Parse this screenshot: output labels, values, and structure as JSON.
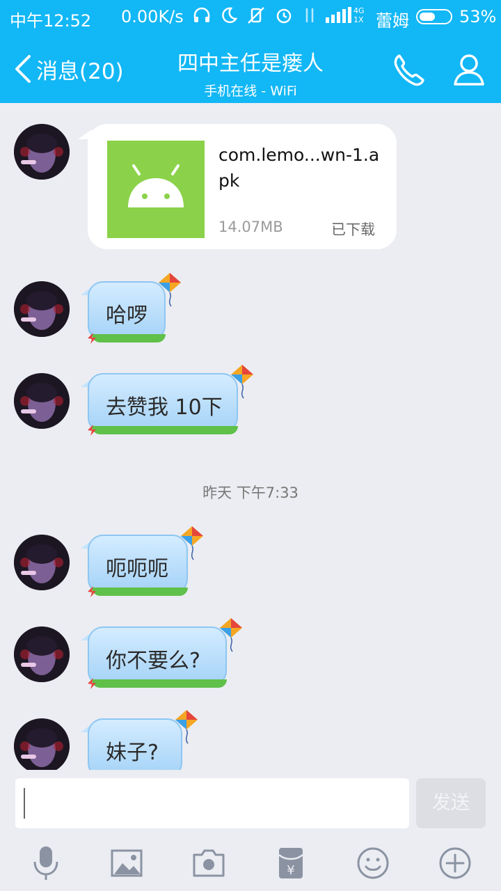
{
  "status_bar": {
    "time": "中午12:52",
    "speed": "0.00K/s",
    "network_top": "4G",
    "network_bottom": "1X",
    "carrier": "蕾姆",
    "battery_percent": "53%",
    "battery_level": 0.53
  },
  "header": {
    "back_label": "消息(20)",
    "title": "四中主任是瘘人",
    "subtitle": "手机在线 - WiFi"
  },
  "messages": {
    "file": {
      "name": "com.lemo...wn-1.apk",
      "size": "14.07MB",
      "status": "已下载"
    },
    "texts": [
      "哈啰",
      "去赞我 10下",
      "呃呃呃",
      "你不要么?",
      "妹子?"
    ],
    "time_separator": "昨天 下午7:33"
  },
  "input": {
    "value": "",
    "send_label": "发送"
  },
  "toolbar": {
    "items": [
      "mic-icon",
      "image-icon",
      "camera-icon",
      "red-packet-icon",
      "emoji-icon",
      "plus-icon"
    ]
  },
  "colors": {
    "accent": "#12b7f5",
    "bubble": "#a4d2f7",
    "grass": "#5fc04a",
    "apk": "#8bd24a"
  }
}
